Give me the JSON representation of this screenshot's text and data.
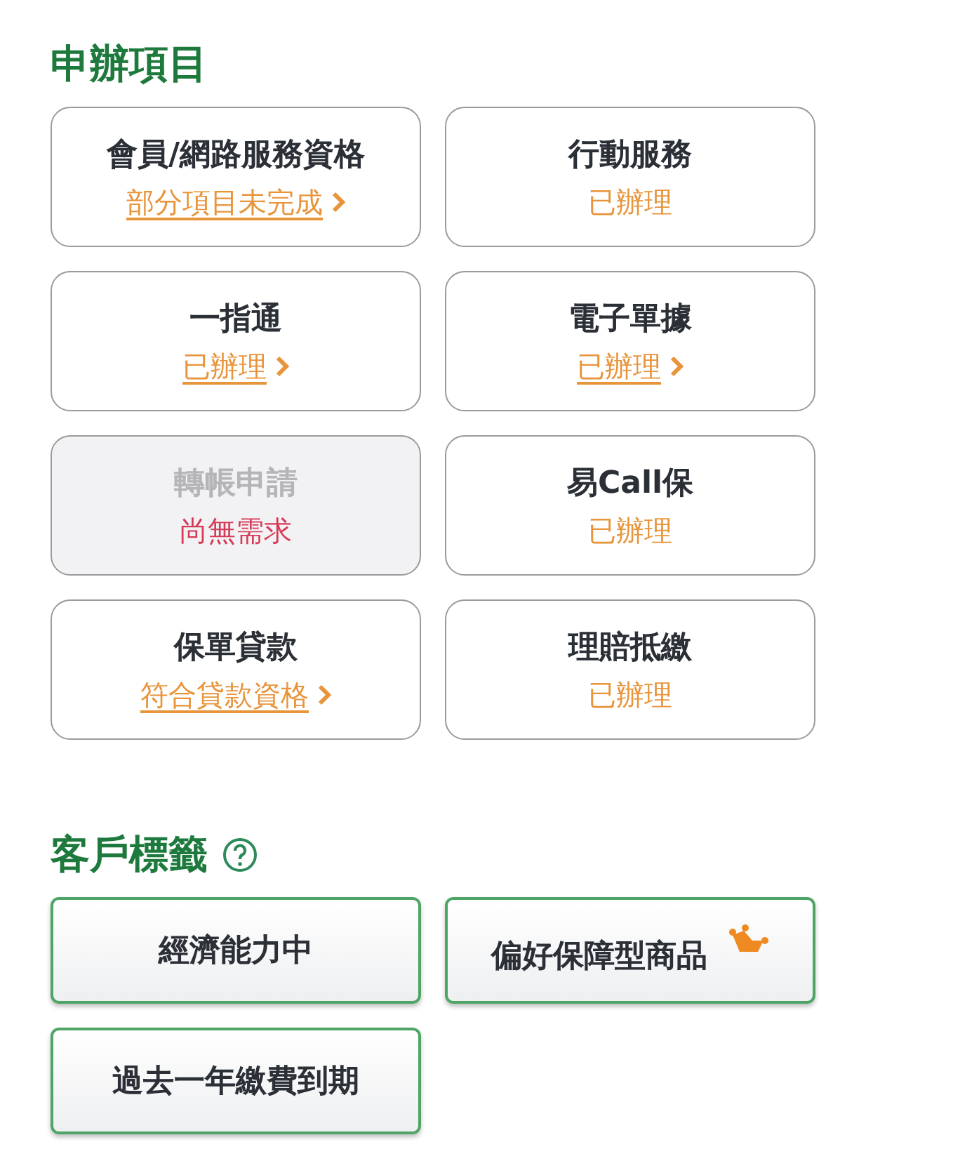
{
  "application_section": {
    "title": "申辦項目",
    "items": [
      {
        "name": "會員/網路服務資格",
        "disabled": false,
        "status": {
          "text": "部分項目未完成",
          "kind": "link"
        }
      },
      {
        "name": "行動服務",
        "disabled": false,
        "status": {
          "text": "已辦理",
          "kind": "done"
        }
      },
      {
        "name": "一指通",
        "disabled": false,
        "status": {
          "text": "已辦理",
          "kind": "link"
        }
      },
      {
        "name": "電子單據",
        "disabled": false,
        "status": {
          "text": "已辦理",
          "kind": "link"
        }
      },
      {
        "name": "轉帳申請",
        "disabled": true,
        "status": {
          "text": "尚無需求",
          "kind": "alert"
        }
      },
      {
        "name": "易Call保",
        "disabled": false,
        "status": {
          "text": "已辦理",
          "kind": "done"
        }
      },
      {
        "name": "保單貸款",
        "disabled": false,
        "status": {
          "text": "符合貸款資格",
          "kind": "link"
        }
      },
      {
        "name": "理賠抵繳",
        "disabled": false,
        "status": {
          "text": "已辦理",
          "kind": "done"
        }
      }
    ]
  },
  "customer_tags": {
    "title": "客戶標籤",
    "tags": [
      {
        "label": "經濟能力中",
        "crowned": false
      },
      {
        "label": "偏好保障型商品",
        "crowned": true
      },
      {
        "label": "過去一年繳費到期",
        "crowned": false
      }
    ]
  }
}
